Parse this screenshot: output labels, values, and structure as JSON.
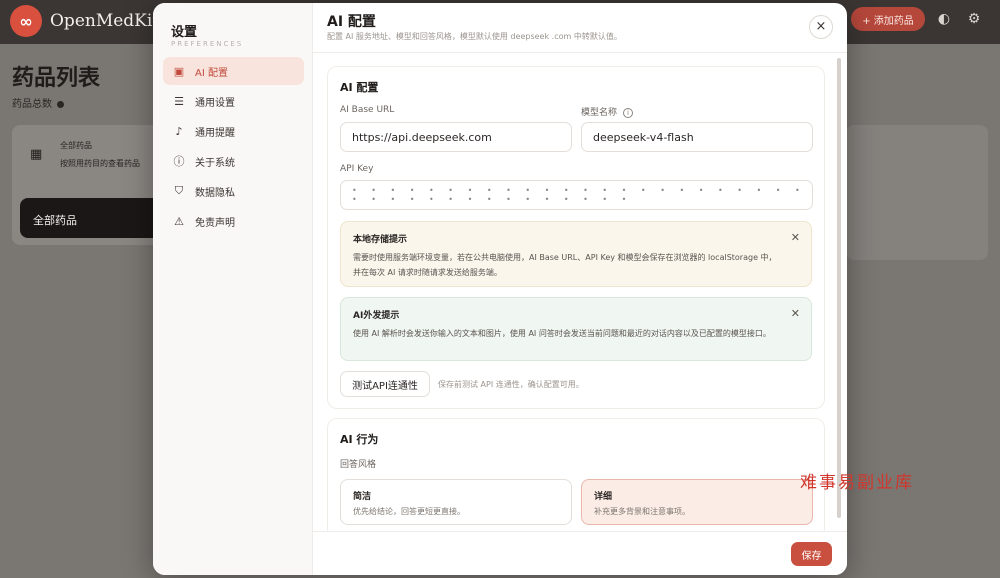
{
  "app": {
    "brand": "OpenMedKit",
    "add_button": "+ 添加药品",
    "logo_glyph": "∞"
  },
  "background": {
    "page_title": "药品列表",
    "page_subtitle": "药品总数",
    "category_title": "全部药品",
    "category_desc": "按照用药目的查看药品",
    "all_button": "全部药品"
  },
  "settings": {
    "title": "设置",
    "subtitle": "PREFERENCES",
    "nav": [
      {
        "label": "AI 配置",
        "icon": "ai-config-icon",
        "glyph": "▣",
        "active": true
      },
      {
        "label": "通用设置",
        "icon": "list-settings-icon",
        "glyph": "☰",
        "active": false
      },
      {
        "label": "通用提醒",
        "icon": "bell-icon",
        "glyph": "♪",
        "active": false
      },
      {
        "label": "关于系统",
        "icon": "info-circle-icon",
        "glyph": "ⓘ",
        "active": false
      },
      {
        "label": "数据隐私",
        "icon": "shield-icon",
        "glyph": "⛉",
        "active": false
      },
      {
        "label": "免责声明",
        "icon": "warning-icon",
        "glyph": "⚠",
        "active": false
      }
    ]
  },
  "main": {
    "title": "AI 配置",
    "subtitle": "配置 AI 服务地址、模型和回答风格，模型默认使用 deepseek .com 中转默认值。",
    "close_glyph": "×",
    "ai_section": {
      "title": "AI 配置",
      "base_url_label": "AI Base URL",
      "base_url_value": "https://api.deepseek.com",
      "model_label": "模型名称",
      "model_value": "deepseek-v4-flash",
      "api_key_label": "API Key",
      "api_key_value": "• • • • • • • • • • • • • • • • • • • • • • • • • • • • • • • • • • • • • • •",
      "notice_local": {
        "title": "本地存储提示",
        "body": "需要时使用服务端环境变量，若在公共电脑使用，AI Base URL、API Key 和模型会保存在浏览器的 localStorage 中，并在每次 AI 请求时随请求发送给服务端。"
      },
      "notice_outbound": {
        "title": "AI外发提示",
        "body": "使用 AI 解析时会发送你输入的文本和图片，使用 AI 问答时会发送当前问题和最近的对话内容以及已配置的模型接口。"
      },
      "test_button": "测试API连通性",
      "test_hint": "保存前测试 API 连通性，确认配置可用。"
    },
    "behavior_section": {
      "title": "AI 行为",
      "style_label": "回答风格",
      "styles": [
        {
          "name": "简洁",
          "desc": "优先给结论，回答更短更直接。",
          "selected": false
        },
        {
          "name": "详细",
          "desc": "补充更多背景和注意事项。",
          "selected": true
        }
      ]
    },
    "save_button": "保存"
  },
  "overlay": {
    "watermark": "难事易副业库"
  }
}
